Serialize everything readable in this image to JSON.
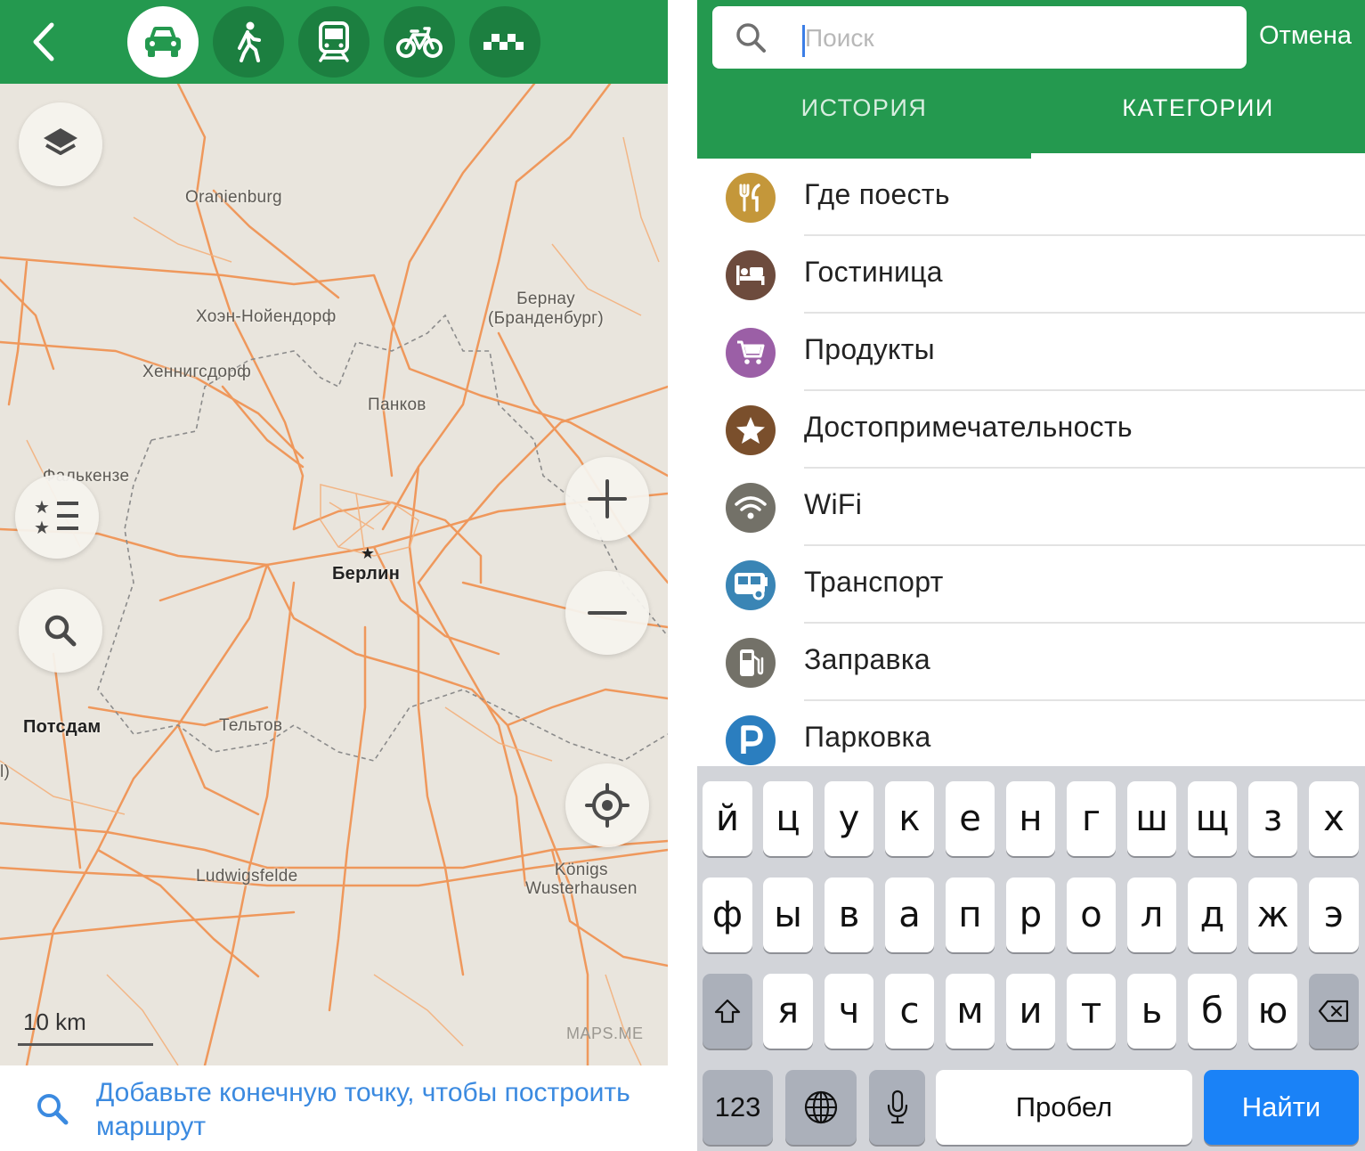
{
  "route_bar": {
    "back_icon": "chevron-left-icon",
    "modes": [
      {
        "name": "car",
        "icon": "car-icon",
        "active": true
      },
      {
        "name": "pedestrian",
        "icon": "walk-icon",
        "active": false
      },
      {
        "name": "transit",
        "icon": "train-icon",
        "active": false
      },
      {
        "name": "bicycle",
        "icon": "bicycle-icon",
        "active": false
      },
      {
        "name": "taxi",
        "icon": "taxi-icon",
        "active": false
      }
    ]
  },
  "map": {
    "labels": {
      "oranienburg": "Oranienburg",
      "bernau": "Бернау\n(Бранденбург)",
      "hohen": "Хоэн-Нойендорф",
      "hennigsdorf": "Хеннигсдорф",
      "pankow": "Панков",
      "falkensee": "Фалькензе",
      "berlin": "Берлин",
      "potsdam": "Потсдам",
      "teltow": "Тельтов",
      "ludwigsfelde": "Ludwigsfelde",
      "konigs": "Königs\nWusterhausen",
      "edge": "l)"
    },
    "scale": "10 km",
    "watermark": "MAPS.ME",
    "colors": {
      "background": "#e9e5dd",
      "road": "#f08a4b",
      "border": "#8b8b8b"
    }
  },
  "hint": {
    "text": "Добавьте конечную точку, чтобы построить маршрут"
  },
  "search": {
    "placeholder": "Поиск",
    "value": "",
    "cancel": "Отмена",
    "tabs": [
      {
        "label": "ИСТОРИЯ",
        "active": false
      },
      {
        "label": "КАТЕГОРИИ",
        "active": true
      }
    ]
  },
  "categories": [
    {
      "label": "Где поесть",
      "icon": "food-icon",
      "color": "#c4973a"
    },
    {
      "label": "Гостиница",
      "icon": "hotel-icon",
      "color": "#6d4b3d"
    },
    {
      "label": "Продукты",
      "icon": "cart-icon",
      "color": "#9b5fa6"
    },
    {
      "label": "Достопримечательность",
      "icon": "star-icon",
      "color": "#7a4f2c"
    },
    {
      "label": "WiFi",
      "icon": "wifi-icon",
      "color": "#737168"
    },
    {
      "label": "Транспорт",
      "icon": "bus-icon",
      "color": "#3a85b5"
    },
    {
      "label": "Заправка",
      "icon": "fuel-icon",
      "color": "#737168"
    },
    {
      "label": "Парковка",
      "icon": "parking-icon",
      "color": "#2b7ebf"
    }
  ],
  "keyboard": {
    "row1": [
      "й",
      "ц",
      "у",
      "к",
      "е",
      "н",
      "г",
      "ш",
      "щ",
      "з",
      "х"
    ],
    "row2": [
      "ф",
      "ы",
      "в",
      "а",
      "п",
      "р",
      "о",
      "л",
      "д",
      "ж",
      "э"
    ],
    "row3": [
      "я",
      "ч",
      "с",
      "м",
      "и",
      "т",
      "ь",
      "б",
      "ю"
    ],
    "numbers": "123",
    "space": "Пробел",
    "go": "Найти"
  },
  "colors": {
    "brand_green": "#24994f",
    "link_blue": "#3b8ae0",
    "go_blue": "#1a82f7"
  }
}
